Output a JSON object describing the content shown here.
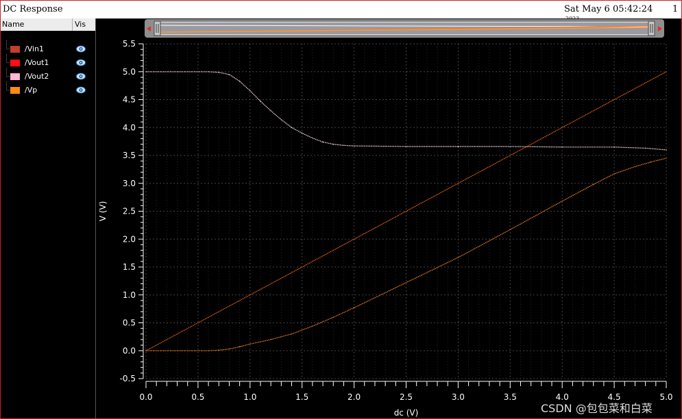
{
  "window": {
    "title": "DC Response",
    "datetime": "Sat May 6 05:42:24",
    "datetime_overflow": "2023",
    "page_number": "1"
  },
  "legend": {
    "header_name": "Name",
    "header_vis": "Vis",
    "items": [
      {
        "label": "/Vin1",
        "color": "#c0402b",
        "icon": "eye-icon"
      },
      {
        "label": "/Vout1",
        "color": "#ff1010",
        "icon": "eye-icon"
      },
      {
        "label": "/Vout2",
        "color": "#ffb8d8",
        "icon": "eye-icon"
      },
      {
        "label": "/Vp",
        "color": "#ff8a10",
        "icon": "eye-icon"
      }
    ]
  },
  "scroller": {
    "left_arrow_icon": "triangle-left-icon",
    "right_arrow_icon": "triangle-right-icon"
  },
  "chart_data": {
    "type": "line",
    "xlabel": "dc (V)",
    "ylabel": "V (V)",
    "xlim": [
      0.0,
      5.0
    ],
    "ylim": [
      -0.5,
      5.5
    ],
    "xticks": [
      "0.0",
      "0.5",
      "1.0",
      "1.5",
      "2.0",
      "2.5",
      "3.0",
      "3.5",
      "4.0",
      "4.5",
      "5.0"
    ],
    "yticks": [
      "5.5",
      "5.0",
      "4.5",
      "4.0",
      "3.5",
      "3.0",
      "2.5",
      "2.0",
      "1.5",
      "1.0",
      "0.5",
      "0.0",
      "-0.5"
    ],
    "grid": true,
    "background": "#000000",
    "series": [
      {
        "name": "/Vout2",
        "color": "#ffe8f0",
        "x": [
          0.0,
          0.3,
          0.5,
          0.6,
          0.7,
          0.8,
          0.9,
          1.0,
          1.1,
          1.2,
          1.3,
          1.4,
          1.5,
          1.6,
          1.7,
          1.8,
          1.9,
          2.0,
          2.5,
          3.0,
          3.5,
          4.0,
          4.5,
          4.8,
          5.0
        ],
        "y": [
          5.0,
          5.0,
          5.0,
          5.0,
          4.99,
          4.95,
          4.83,
          4.66,
          4.47,
          4.3,
          4.14,
          4.0,
          3.9,
          3.81,
          3.74,
          3.7,
          3.68,
          3.67,
          3.66,
          3.66,
          3.66,
          3.65,
          3.65,
          3.63,
          3.6
        ]
      },
      {
        "name": "/Vp",
        "color": "#ff6a10",
        "x": [
          0.0,
          5.0
        ],
        "y": [
          0.0,
          5.0
        ]
      },
      {
        "name": "/Vout1",
        "color": "#ff8a20",
        "x": [
          0.0,
          0.3,
          0.6,
          0.7,
          0.8,
          0.9,
          1.0,
          1.2,
          1.4,
          1.6,
          1.8,
          2.0,
          2.5,
          3.0,
          3.5,
          4.0,
          4.3,
          4.5,
          4.7,
          4.85,
          5.0
        ],
        "y": [
          0.0,
          0.0,
          0.0,
          0.01,
          0.03,
          0.07,
          0.12,
          0.2,
          0.3,
          0.44,
          0.6,
          0.77,
          1.22,
          1.67,
          2.17,
          2.68,
          2.98,
          3.17,
          3.3,
          3.38,
          3.45
        ]
      }
    ]
  }
}
